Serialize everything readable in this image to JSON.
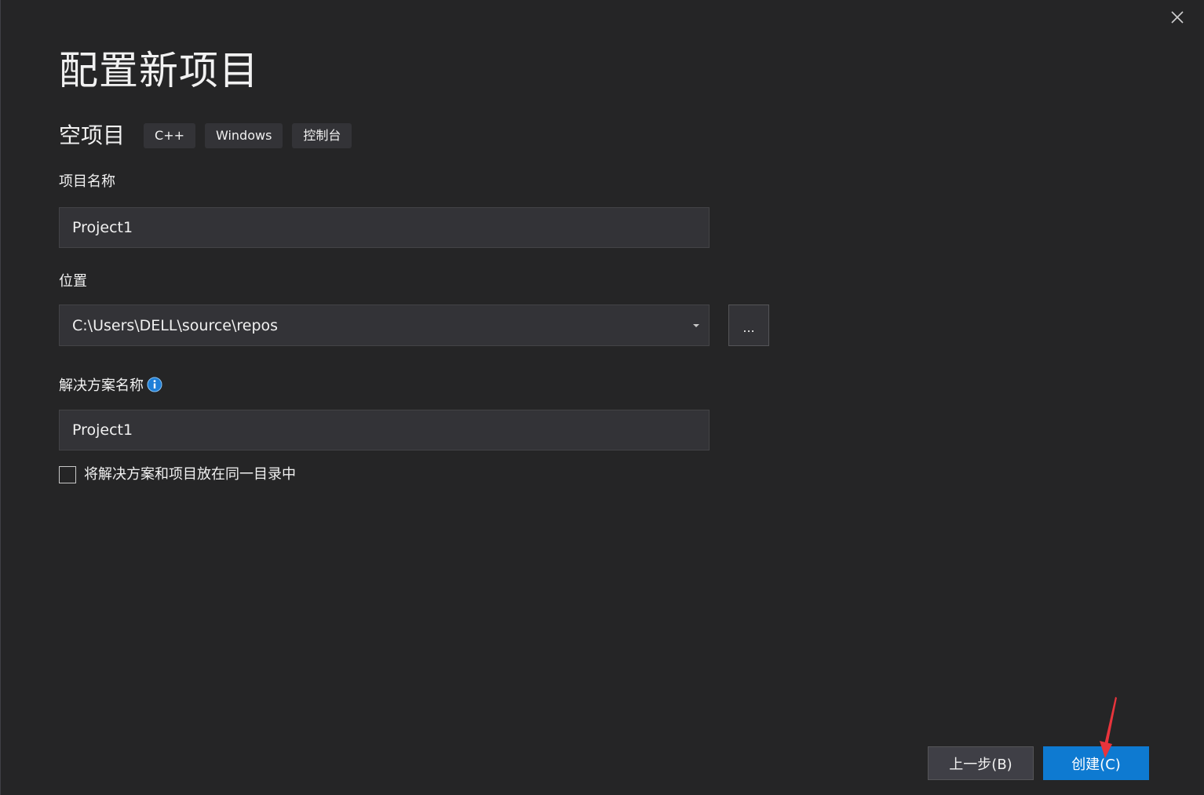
{
  "dialog": {
    "title": "配置新项目",
    "close_icon": "close-icon"
  },
  "template": {
    "name": "空项目",
    "tags": [
      "C++",
      "Windows",
      "控制台"
    ]
  },
  "project_name": {
    "label": "项目名称",
    "value": "Project1"
  },
  "location": {
    "label": "位置",
    "value": "C:\\Users\\DELL\\source\\repos",
    "browse_label": "..."
  },
  "solution_name": {
    "label": "解决方案名称",
    "value": "Project1",
    "info_icon": "info-icon"
  },
  "same_directory": {
    "label": "将解决方案和项目放在同一目录中",
    "checked": false
  },
  "buttons": {
    "back_label": "上一步(B)",
    "create_label": "创建(C)"
  },
  "colors": {
    "background": "#252526",
    "input_background": "#333337",
    "primary_button": "#0e7ad1",
    "annotation_arrow": "#e8343c"
  }
}
